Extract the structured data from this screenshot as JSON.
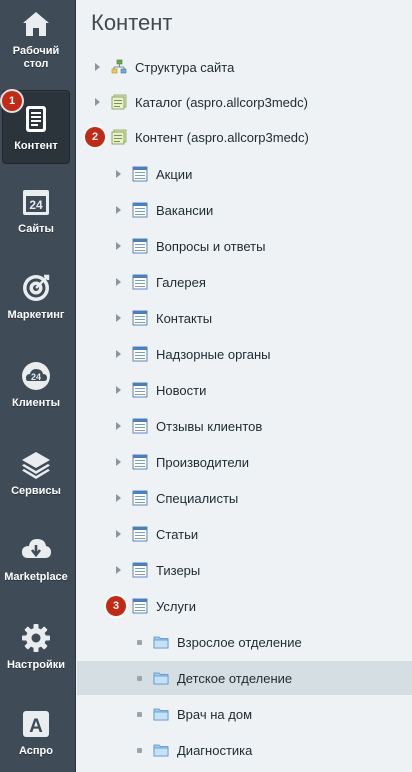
{
  "sidebar": {
    "items": [
      {
        "label": "Рабочий стол",
        "icon": "home-icon"
      },
      {
        "label": "Контент",
        "icon": "document-icon",
        "active": true
      },
      {
        "label": "Сайты",
        "icon": "calendar-24-icon"
      },
      {
        "label": "Маркетинг",
        "icon": "target-icon"
      },
      {
        "label": "Клиенты",
        "icon": "cloud-24-icon"
      },
      {
        "label": "Сервисы",
        "icon": "layers-icon"
      },
      {
        "label": "Marketplace",
        "icon": "cloud-download-icon"
      },
      {
        "label": "Настройки",
        "icon": "gear-icon"
      },
      {
        "label": "Аспро",
        "icon": "letter-a-icon"
      }
    ]
  },
  "badges": [
    "1",
    "2",
    "3"
  ],
  "main": {
    "title": "Контент",
    "tree": [
      {
        "label": "Структура сайта",
        "icon": "site-structure-icon"
      },
      {
        "label": "Каталог (aspro.allcorp3medc)",
        "icon": "iblock-type-icon"
      },
      {
        "label": "Контент (aspro.allcorp3medc)",
        "icon": "iblock-type-icon"
      },
      {
        "label": "Акции",
        "icon": "iblock-icon"
      },
      {
        "label": "Вакансии",
        "icon": "iblock-icon"
      },
      {
        "label": "Вопросы и ответы",
        "icon": "iblock-icon"
      },
      {
        "label": "Галерея",
        "icon": "iblock-icon"
      },
      {
        "label": "Контакты",
        "icon": "iblock-icon"
      },
      {
        "label": "Надзорные органы",
        "icon": "iblock-icon"
      },
      {
        "label": "Новости",
        "icon": "iblock-icon"
      },
      {
        "label": "Отзывы клиентов",
        "icon": "iblock-icon"
      },
      {
        "label": "Производители",
        "icon": "iblock-icon"
      },
      {
        "label": "Специалисты",
        "icon": "iblock-icon"
      },
      {
        "label": "Статьи",
        "icon": "iblock-icon"
      },
      {
        "label": "Тизеры",
        "icon": "iblock-icon"
      },
      {
        "label": "Услуги",
        "icon": "iblock-icon"
      },
      {
        "label": "Взрослое отделение",
        "icon": "folder-icon"
      },
      {
        "label": "Детское отделение",
        "icon": "folder-icon",
        "selected": true
      },
      {
        "label": "Врач на дом",
        "icon": "folder-icon"
      },
      {
        "label": "Диагностика",
        "icon": "folder-icon"
      }
    ]
  },
  "colors": {
    "sidebar_bg": "#3f4b56",
    "sidebar_active_bg": "#2b333b",
    "main_bg": "#eef2f4",
    "selected_row_bg": "#d5dee3",
    "badge_red": "#c22a16"
  }
}
